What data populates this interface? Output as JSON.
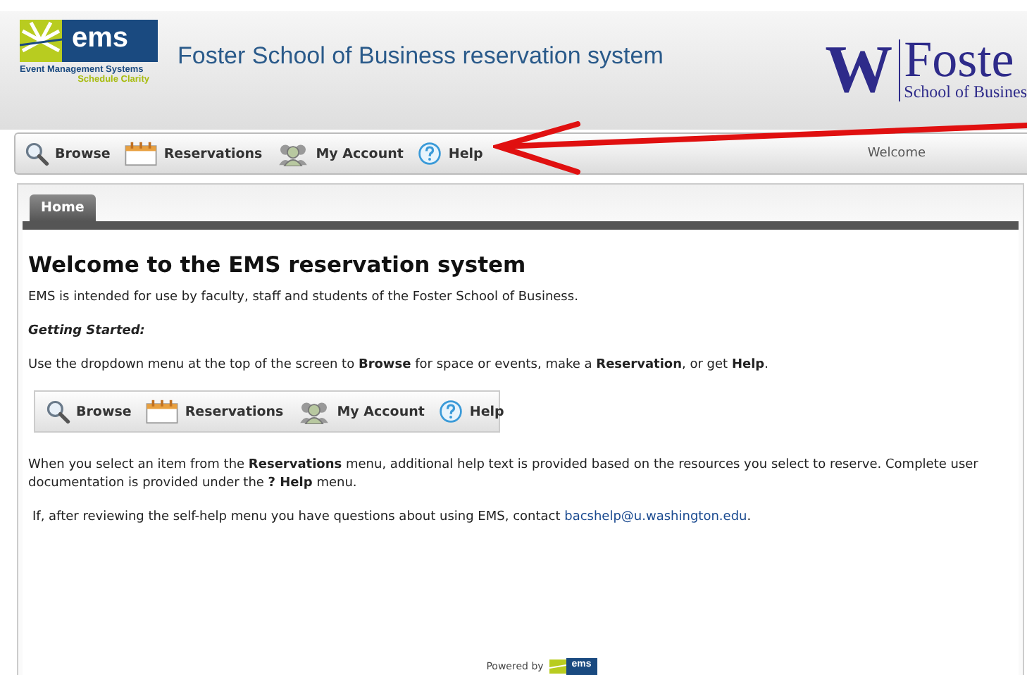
{
  "header": {
    "logo": {
      "mark": "ems",
      "line1": "Event Management Systems",
      "line2": "Schedule Clarity"
    },
    "title": "Foster School of Business reservation system",
    "school_logo": {
      "letter": "W",
      "name": "Foste",
      "subtitle": "School of Busines"
    }
  },
  "nav": [
    {
      "label": "Browse",
      "kind": "search"
    },
    {
      "label": "Reservations",
      "kind": "calendar"
    },
    {
      "label": "My Account",
      "kind": "people"
    },
    {
      "label": "Help",
      "kind": "help"
    }
  ],
  "welcome": "Welcome",
  "tabs": [
    {
      "label": "Home",
      "selected": true
    }
  ],
  "content": {
    "heading": "Welcome to the EMS reservation system",
    "intro": "EMS is intended for use by faculty, staff and students of the Foster School of Business.",
    "getting_started": "Getting Started:",
    "instructions": "Use the dropdown menu at the top of the screen to **Browse** for space or events, make a **Reservation**, or get **Help**.",
    "menu_sample": [
      {
        "label": "Browse",
        "kind": "search"
      },
      {
        "label": "Reservations",
        "kind": "calendar"
      },
      {
        "label": "My Account",
        "kind": "people"
      },
      {
        "label": "Help",
        "kind": "help"
      }
    ],
    "help_text": "When you select an item from the **Reservations** menu, additional help text is provided based on the resources you select to reserve. Complete user documentation is provided under the **? Help** menu.",
    "contact_text": "If, after reviewing the self-help menu you have questions about using EMS, contact ",
    "contact_email": "bacshelp@u.washington.edu",
    "contact_end": "."
  },
  "footer": {
    "powered_by": "Powered by",
    "logo": "ems"
  }
}
